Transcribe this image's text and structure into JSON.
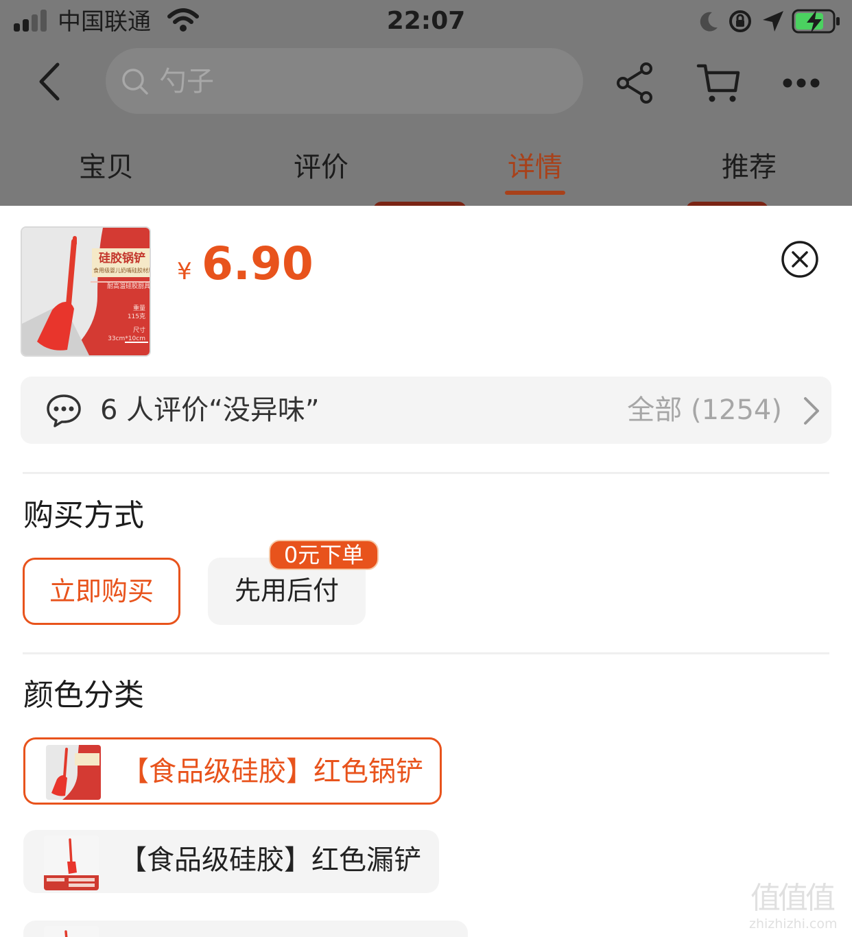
{
  "status_bar": {
    "carrier": "中国联通",
    "time": "22:07"
  },
  "nav": {
    "search_placeholder": "勺子",
    "icons": [
      "back-icon",
      "search-icon",
      "share-icon",
      "cart-icon",
      "more-icon"
    ]
  },
  "tabs": [
    {
      "label": "宝贝"
    },
    {
      "label": "评价"
    },
    {
      "label": "详情",
      "active": true
    },
    {
      "label": "推荐"
    }
  ],
  "product": {
    "thumb_title": "硅胶锅铲",
    "thumb_subtitle": "食用级婴儿奶嘴硅胶材质",
    "thumb_feature": "耐高温硅胶厨具",
    "thumb_weight_label": "重量",
    "thumb_weight_value": "115克",
    "thumb_size_label": "尺寸",
    "thumb_size_value": "33cm*10cm",
    "currency": "¥",
    "price": "6.90"
  },
  "review_bar": {
    "summary": "6 人评价“没异味”",
    "all_label": "全部 (1254)"
  },
  "purchase": {
    "title": "购买方式",
    "options": [
      {
        "label": "立即购买",
        "selected": true
      },
      {
        "label": "先用后付",
        "selected": false
      }
    ],
    "badge": "0元下单"
  },
  "color": {
    "title": "颜色分类",
    "options": [
      {
        "label": "【食品级硅胶】红色锅铲",
        "selected": true
      },
      {
        "label": "【食品级硅胶】红色漏铲",
        "selected": false
      }
    ]
  },
  "watermark": {
    "mark": "值值值",
    "url": "zhizhizhi.com"
  },
  "colors": {
    "accent": "#e8531c",
    "tab_active_dim": "#a8411a",
    "overlay": "#7a7a7a",
    "chip_bg": "#f4f4f4",
    "product_red": "#e23a2c"
  }
}
